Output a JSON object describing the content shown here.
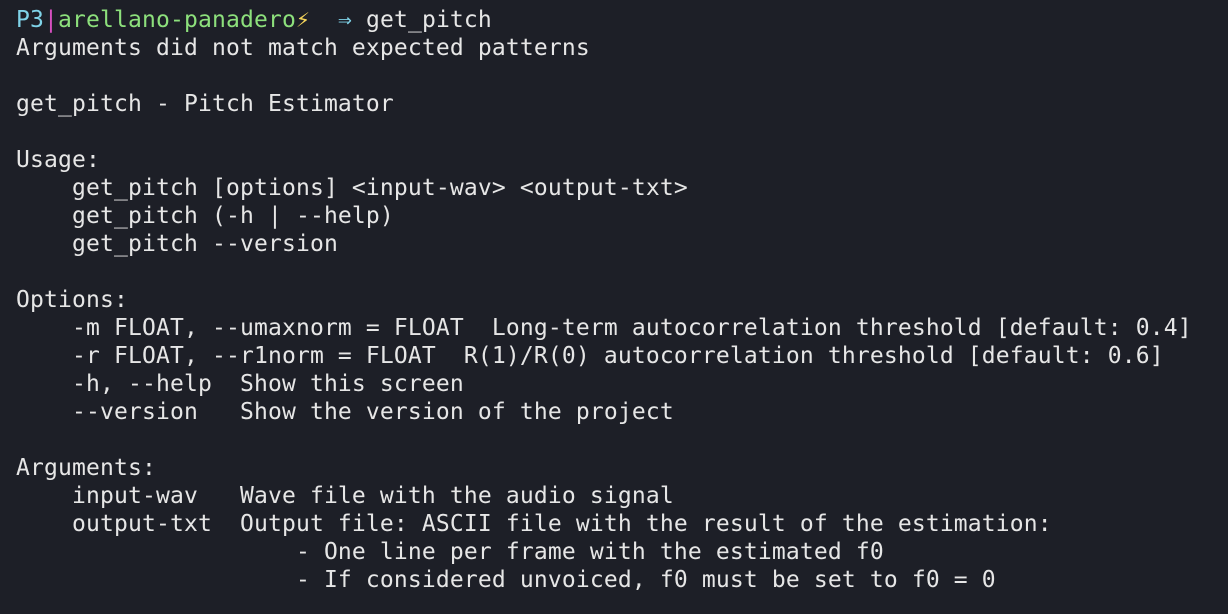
{
  "prompt": {
    "host": "P3",
    "separator": "|",
    "branch": "arellano-panadero",
    "bolt_icon": "⚡",
    "arrow_icon": "⇒",
    "command": "get_pitch",
    "colors": {
      "host": "#7fd3e8",
      "separator": "#d64fc0",
      "branch": "#8de07c",
      "bolt": "#f3d35a",
      "text": "#e6e6e6",
      "background": "#1d1f27"
    }
  },
  "output": {
    "error": "Arguments did not match expected patterns",
    "title": "get_pitch - Pitch Estimator",
    "usage_header": "Usage:",
    "usage": [
      "    get_pitch [options] <input-wav> <output-txt>",
      "    get_pitch (-h | --help)",
      "    get_pitch --version"
    ],
    "options_header": "Options:",
    "options": [
      "    -m FLOAT, --umaxnorm = FLOAT  Long-term autocorrelation threshold [default: 0.4]",
      "    -r FLOAT, --r1norm = FLOAT  R(1)/R(0) autocorrelation threshold [default: 0.6]",
      "    -h, --help  Show this screen",
      "    --version   Show the version of the project"
    ],
    "arguments_header": "Arguments:",
    "arguments": [
      "    input-wav   Wave file with the audio signal",
      "    output-txt  Output file: ASCII file with the result of the estimation:",
      "                    - One line per frame with the estimated f0",
      "                    - If considered unvoiced, f0 must be set to f0 = 0"
    ]
  }
}
